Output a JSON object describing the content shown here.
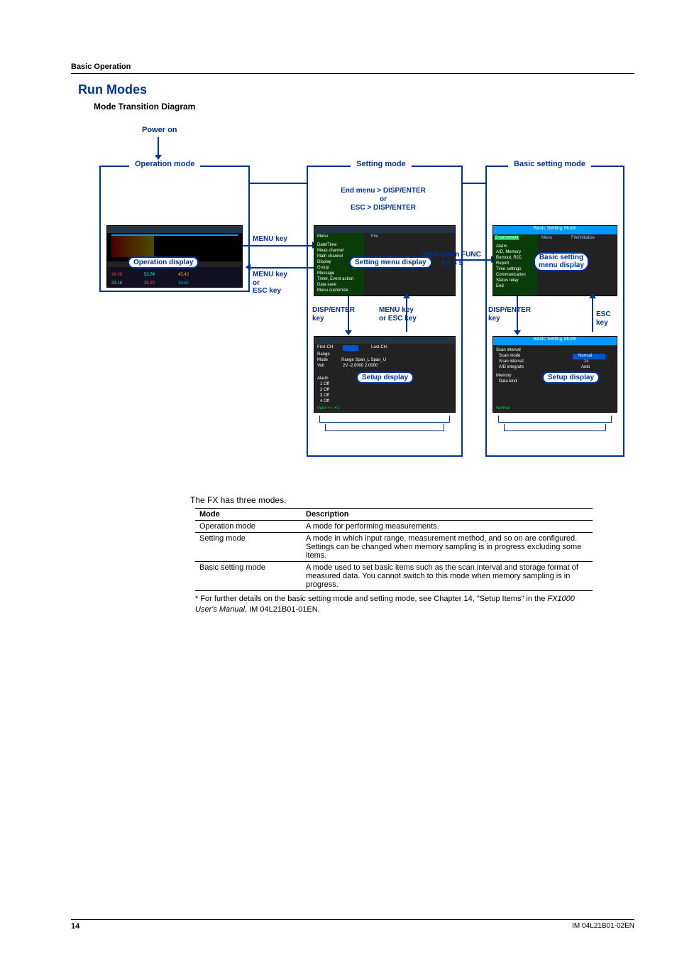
{
  "section_title": "Basic Operation",
  "heading": "Run Modes",
  "subheading": "Mode Transition Diagram",
  "diagram": {
    "power_on": "Power on",
    "operation_mode": "Operation mode",
    "setting_mode": "Setting mode",
    "basic_setting_mode": "Basic setting mode",
    "end_menu_label_1": "End menu > DISP/ENTER",
    "end_menu_label_2": "or",
    "end_menu_label_3": "ESC > DISP/ENTER",
    "menu_key": "MENU key",
    "menu_key_or_esc_1": "MENU key",
    "menu_key_or_esc_2": "or",
    "menu_key_or_esc_3": "ESC key",
    "operation_display": "Operation display",
    "setting_menu_display": "Setting menu display",
    "hold_down_func_1": "Hold down FUNC",
    "hold_down_func_2": "for 3 s",
    "basic_setting_menu_display_1": "Basic setting",
    "basic_setting_menu_display_2": "menu display",
    "disp_enter_key": "DISP/ENTER",
    "disp_enter_key_2": "key",
    "menu_key_or_esc_key_1": "MENU key",
    "menu_key_or_esc_key_2": "or ESC key",
    "esc_key": "ESC key",
    "setup_display": "Setup display"
  },
  "body_intro": "The FX has three modes.",
  "table": {
    "col_mode": "Mode",
    "col_desc": "Description",
    "rows": [
      {
        "mode": "Operation mode",
        "desc": "A mode for performing measurements."
      },
      {
        "mode": "Setting mode",
        "desc": "A mode in which input range, measurement method, and so on are configured. Settings can be changed when memory sampling is in progress excluding some items."
      },
      {
        "mode": "Basic setting mode",
        "desc": "A mode used to set basic items such as the scan interval and storage format of measured data. You cannot switch to this mode when memory sampling is in progress."
      }
    ]
  },
  "footnote_prefix": "* For further details on the basic setting mode and setting mode, see Chapter 14, \"Setup Items\" in the ",
  "footnote_italic": "FX1000 User's Manual",
  "footnote_suffix": ", IM 04L21B01-01EN.",
  "footer": {
    "page": "14",
    "doc": "IM 04L21B01-02EN"
  }
}
